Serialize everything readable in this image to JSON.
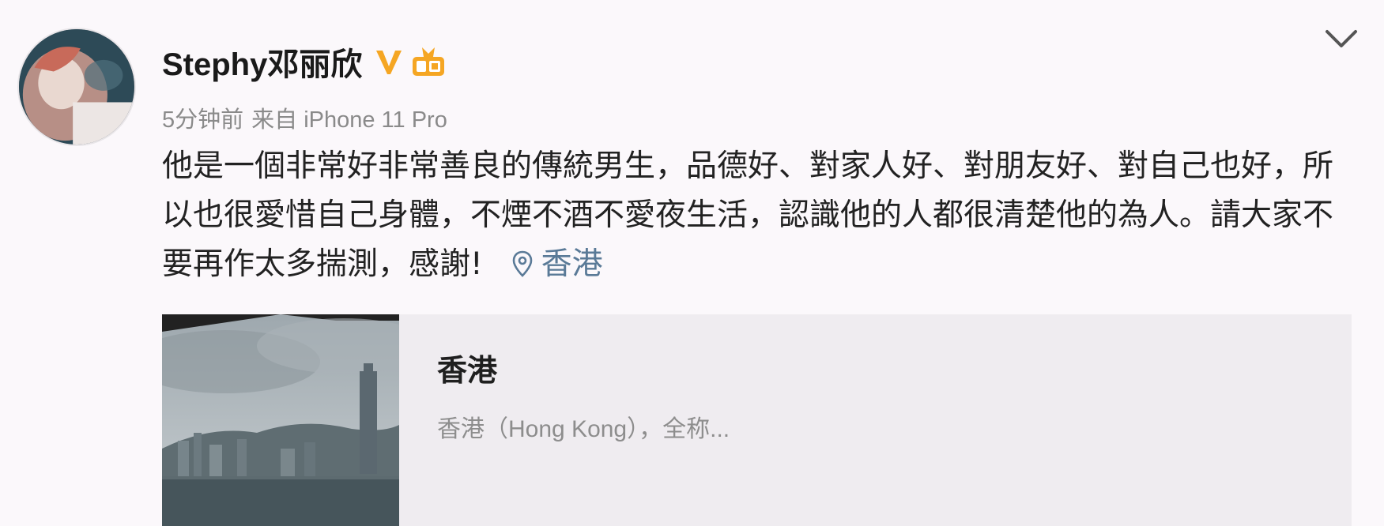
{
  "post": {
    "author": {
      "name": "Stephy邓丽欣"
    },
    "meta": {
      "time": "5分钟前",
      "source": "来自 iPhone 11 Pro"
    },
    "text": "他是一個非常好非常善良的傳統男生，品德好、對家人好、對朋友好、對自己也好，所以也很愛惜自己身體，不煙不酒不愛夜生活，認識他的人都很清楚他的為人。請大家不要再作太多揣測，感謝!",
    "location_label": "香港",
    "location_card": {
      "title": "香港",
      "description": "香港（Hong Kong），全称..."
    }
  },
  "icons": {
    "verified": "verified-v-icon",
    "level": "level-badge-icon",
    "location": "location-pin-icon",
    "more": "chevron-down-icon"
  },
  "colors": {
    "verified_orange": "#f5a623",
    "link_blue": "#5a7a97",
    "meta_gray": "#8a8a8a",
    "card_bg": "#efecf0"
  }
}
